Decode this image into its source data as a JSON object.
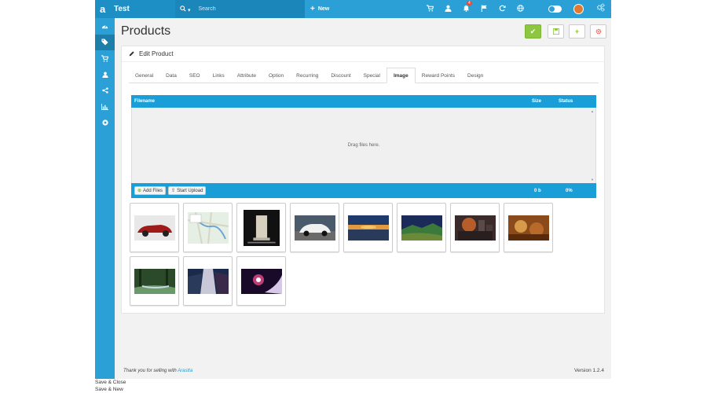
{
  "topbar": {
    "brand_logo": "a",
    "brand_title": "Test",
    "search_placeholder": "Search",
    "new_label": "New",
    "notification_count": "4",
    "icons": [
      "cart-icon",
      "user-icon",
      "bell-icon",
      "flag-icon",
      "refresh-icon",
      "globe-icon",
      "toggle",
      "avatar",
      "cogs-icon"
    ]
  },
  "sidebar": {
    "items": [
      {
        "icon": "dashboard-icon",
        "active": false
      },
      {
        "icon": "tags-icon",
        "active": true
      },
      {
        "icon": "cart-icon",
        "active": false
      },
      {
        "icon": "user-icon",
        "active": false
      },
      {
        "icon": "share-icon",
        "active": false
      },
      {
        "icon": "chart-icon",
        "active": false
      },
      {
        "icon": "settings-circle-icon",
        "active": false
      }
    ]
  },
  "page": {
    "title": "Products",
    "panel_title": "Edit Product"
  },
  "tabs": [
    "General",
    "Data",
    "SEO",
    "Links",
    "Attribute",
    "Option",
    "Recurring",
    "Discount",
    "Special",
    "Image",
    "Reward Points",
    "Design"
  ],
  "active_tab": "Image",
  "uploader": {
    "col_filename": "Filename",
    "col_size": "Size",
    "col_status": "Status",
    "drop_text": "Drag files here.",
    "add_files": "Add Files",
    "start_upload": "Start Upload",
    "total_size": "0 b",
    "total_status": "0%"
  },
  "thumbnails": [
    {
      "name": "red-car-image",
      "colors": [
        "#e8e8e8",
        "#a11a1a"
      ]
    },
    {
      "name": "map-image",
      "colors": [
        "#e6efe3",
        "#6fa6d6"
      ]
    },
    {
      "name": "monument-image",
      "colors": [
        "#111111",
        "#d8d0bf"
      ]
    },
    {
      "name": "white-car-image",
      "colors": [
        "#4a5a6a",
        "#f0f0f0"
      ]
    },
    {
      "name": "sunset-image",
      "colors": [
        "#1f3a6a",
        "#e39a3c"
      ]
    },
    {
      "name": "landscape-image",
      "colors": [
        "#1a2b5a",
        "#3c7a3c"
      ]
    },
    {
      "name": "city-fire-image",
      "colors": [
        "#3a2a2a",
        "#d76a2a"
      ]
    },
    {
      "name": "painting-image",
      "colors": [
        "#8a4a1a",
        "#d69a4a"
      ]
    },
    {
      "name": "forest-image",
      "colors": [
        "#2a4a2a",
        "#6a9a6a"
      ]
    },
    {
      "name": "waterfall-image",
      "colors": [
        "#1a2a4a",
        "#c8c8d8"
      ]
    },
    {
      "name": "space-image",
      "colors": [
        "#1a0a2a",
        "#e84a8a"
      ]
    }
  ],
  "footer": {
    "thanks_prefix": "Thank you for selling with ",
    "thanks_link": "Arastta",
    "version": "Version 1.2.4"
  },
  "below_page": {
    "save_close": "Save & Close",
    "save_new": "Save & New"
  },
  "colors": {
    "accent": "#2aa0d6",
    "accent_dark": "#1d8fc4",
    "save_green": "#8dc63f",
    "delete_red": "#e74c3c"
  }
}
